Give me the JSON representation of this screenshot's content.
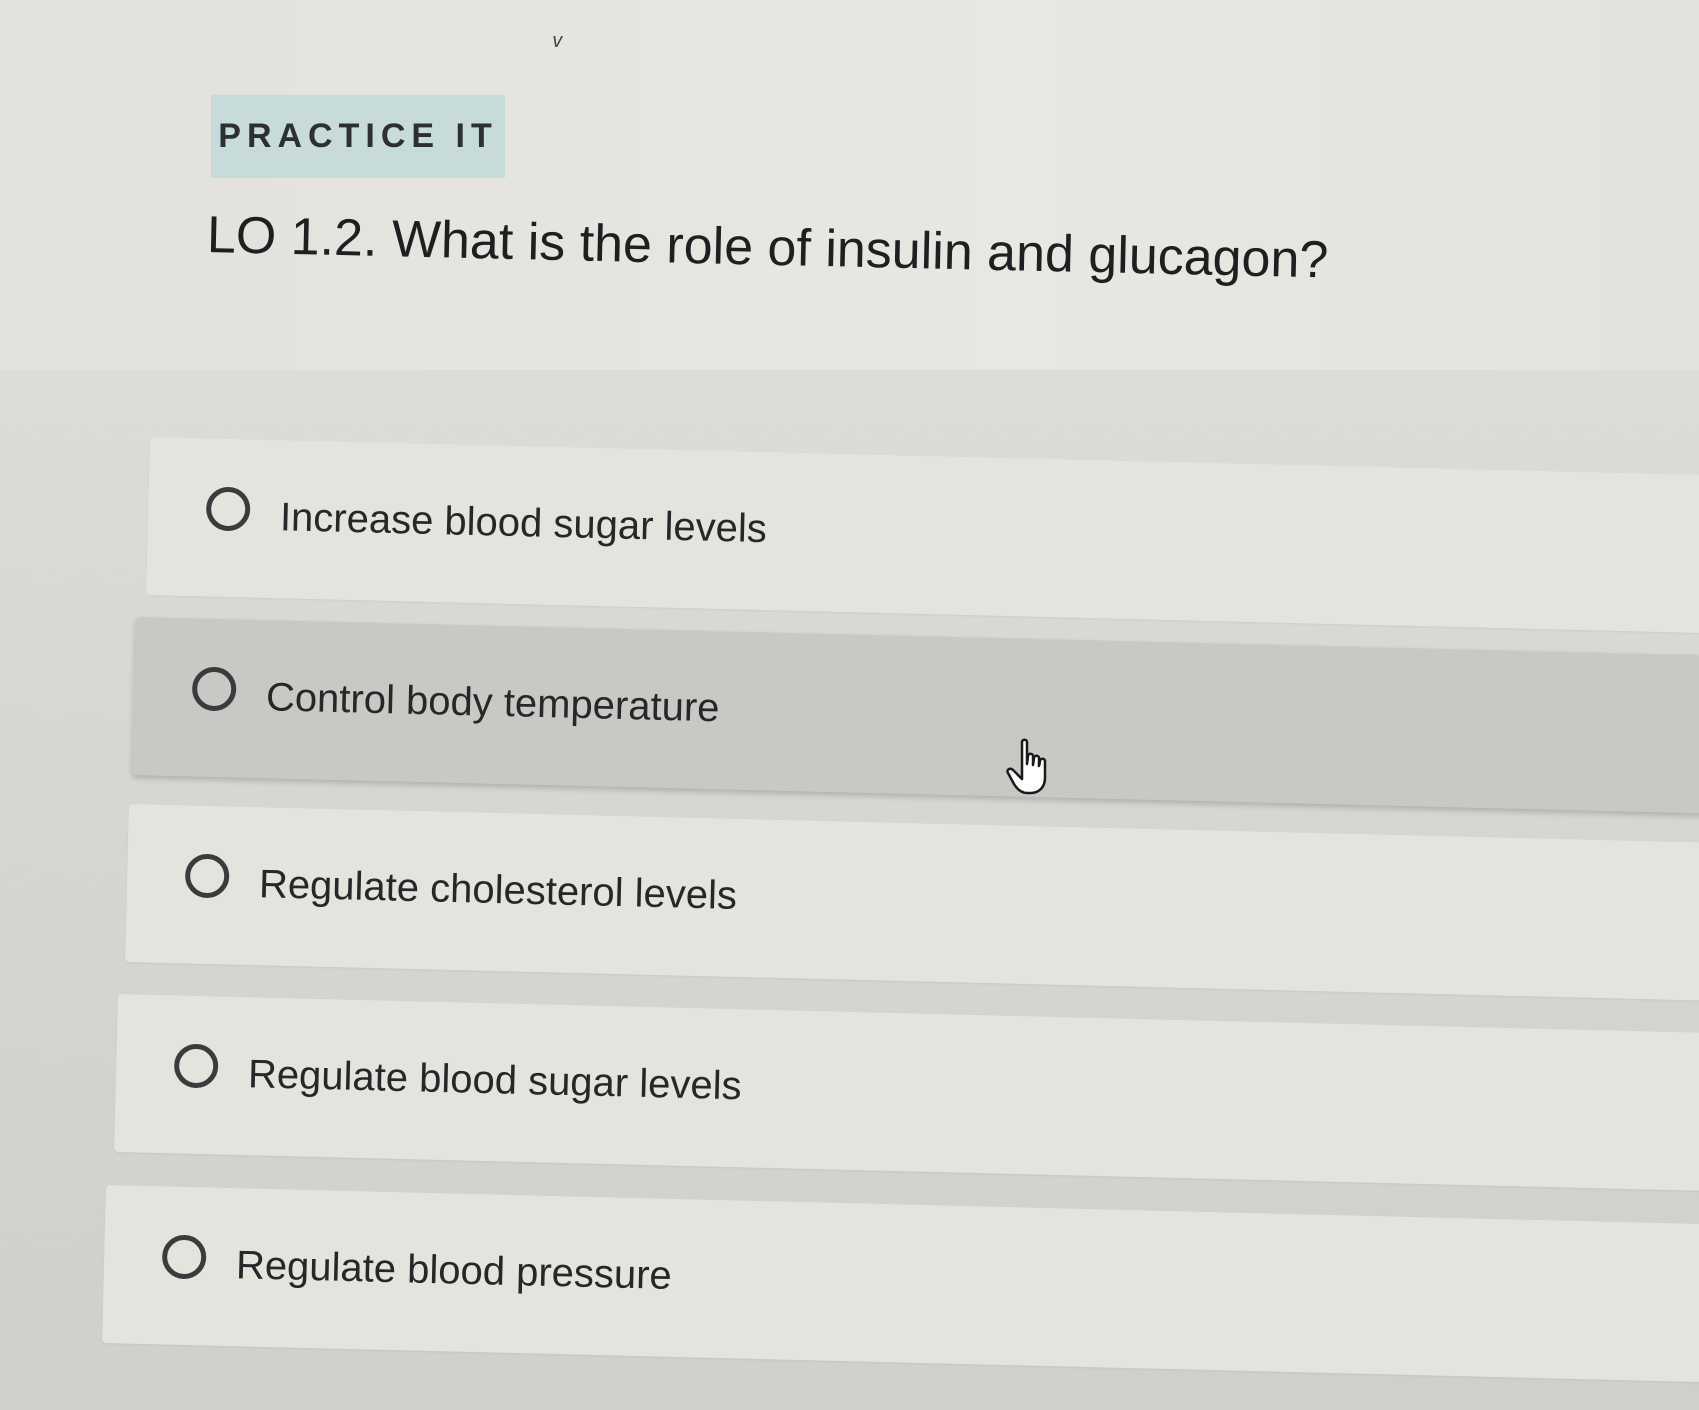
{
  "badge": {
    "label": "PRACTICE IT"
  },
  "question": {
    "text": "LO 1.2. What is the role of insulin and glucagon?"
  },
  "options": [
    {
      "label": "Increase blood sugar levels",
      "hovered": false
    },
    {
      "label": "Control body temperature",
      "hovered": true
    },
    {
      "label": "Regulate cholesterol levels",
      "hovered": false
    },
    {
      "label": "Regulate blood sugar levels",
      "hovered": false
    },
    {
      "label": "Regulate blood pressure",
      "hovered": false
    }
  ],
  "cursor": {
    "icon": "pointer-hand-icon"
  },
  "colors": {
    "badge_background": "#c7dcda",
    "option_background": "#e5e3de",
    "option_hover_background": "#c9c8c4",
    "text": "#262729"
  }
}
